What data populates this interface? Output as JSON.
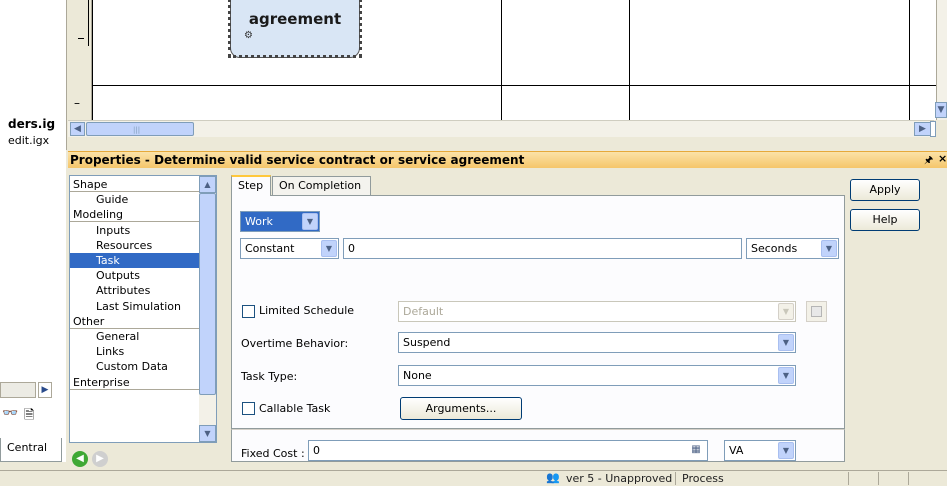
{
  "canvas": {
    "task_label": "agreement",
    "ruler_minus": "–",
    "left_ruler_mark": "≺"
  },
  "explorer": {
    "file1": "ders.ig",
    "file2": "edit.igx",
    "central_tab": "Central"
  },
  "properties": {
    "title": "Properties - Determine valid service contract or service agreement",
    "pin_glyph": "ᵖ",
    "close_glyph": "×",
    "categories": [
      {
        "label": "Shape",
        "type": "group"
      },
      {
        "label": "Guide",
        "type": "item"
      },
      {
        "label": "Modeling",
        "type": "group"
      },
      {
        "label": "Inputs",
        "type": "item"
      },
      {
        "label": "Resources",
        "type": "item"
      },
      {
        "label": "Task",
        "type": "item",
        "selected": true
      },
      {
        "label": "Outputs",
        "type": "item"
      },
      {
        "label": "Attributes",
        "type": "item"
      },
      {
        "label": "Last Simulation",
        "type": "item"
      },
      {
        "label": "Other",
        "type": "group"
      },
      {
        "label": "General",
        "type": "item"
      },
      {
        "label": "Links",
        "type": "item"
      },
      {
        "label": "Custom Data",
        "type": "item"
      },
      {
        "label": "Enterprise",
        "type": "group"
      }
    ],
    "tabs": [
      {
        "label": "Step",
        "active": true
      },
      {
        "label": "On Completion",
        "active": false
      }
    ],
    "step": {
      "work_type": "Work",
      "duration_type": "Constant",
      "duration_value": "0",
      "duration_unit": "Seconds",
      "limited_schedule_label": "Limited Schedule",
      "limited_schedule_checked": false,
      "schedule_value": "Default",
      "overtime_label": "Overtime Behavior:",
      "overtime_value": "Suspend",
      "task_type_label": "Task Type:",
      "task_type_value": "None",
      "callable_label": "Callable Task",
      "callable_checked": false,
      "arguments_button": "Arguments...",
      "fixed_cost_label": "Fixed Cost :",
      "fixed_cost_value": "0",
      "currency": "VA"
    },
    "buttons": {
      "apply": "Apply",
      "help": "Help"
    }
  },
  "status": {
    "version": "ver 5 - Unapproved",
    "mode": "Process"
  },
  "colors": {
    "title_bar": "#f5c66a",
    "selection": "#316ac5",
    "task_fill": "#d9e6f5"
  }
}
